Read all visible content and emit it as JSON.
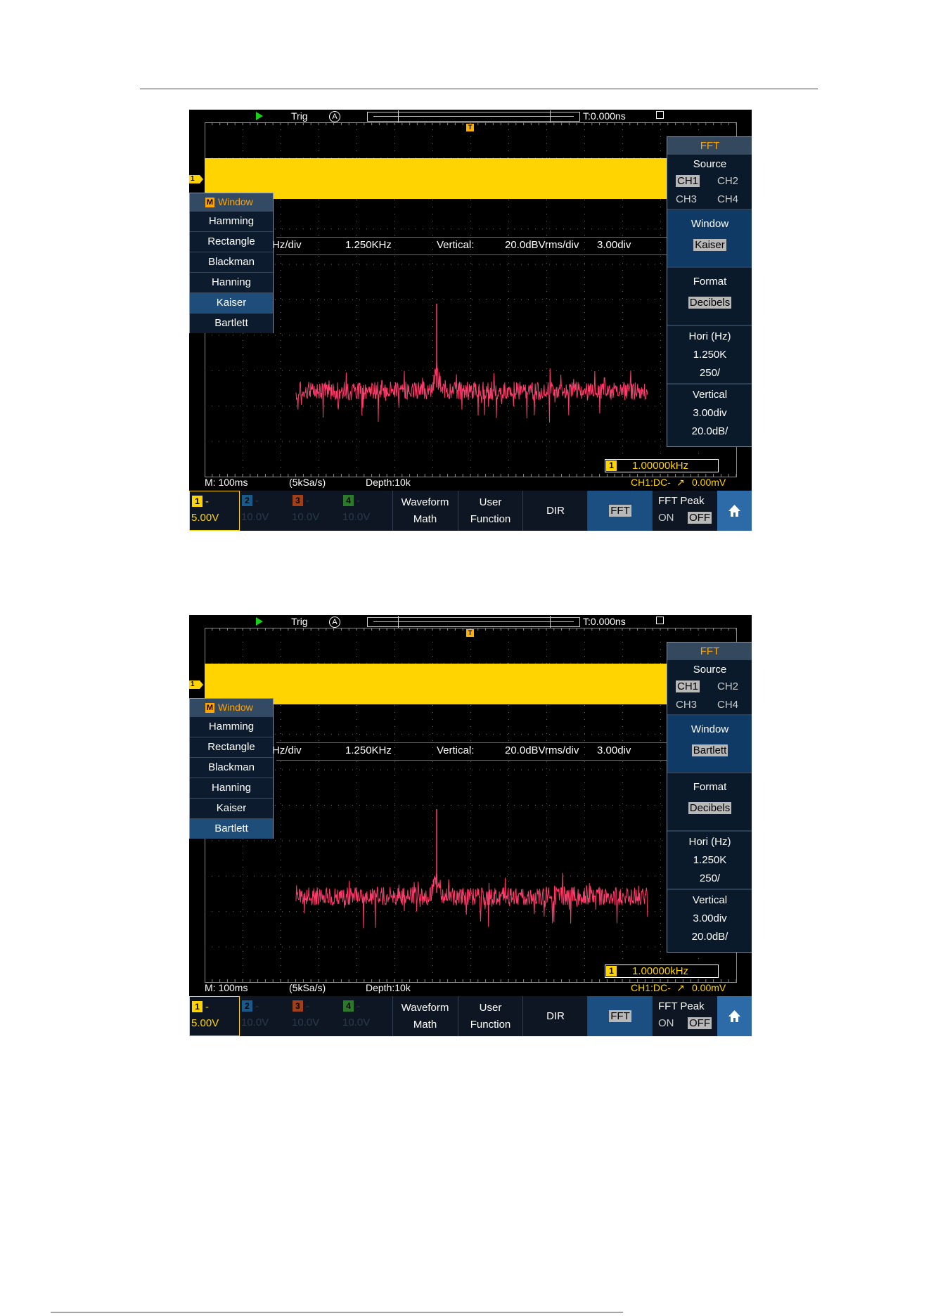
{
  "screens": [
    {
      "topbar": {
        "trig_label": "Trig",
        "auto_label": "A",
        "time_label": "T:0.000ns"
      },
      "ch1_marker": "1",
      "t_marker": "T",
      "window_menu": {
        "m": "M",
        "title": "Window",
        "items": [
          "Hamming",
          "Rectangle",
          "Blackman",
          "Hanning",
          "Kaiser",
          "Bartlett"
        ],
        "selected": "Kaiser"
      },
      "fft_info": {
        "hz_div": "Hz/div",
        "freq": "1.250KHz",
        "vertical": "Vertical:",
        "dbvrms": "20.0dBVrms/div",
        "div": "3.00div"
      },
      "side_menu": {
        "title": "FFT",
        "source_label": "Source",
        "source_options": [
          "CH1",
          "CH2",
          "CH3",
          "CH4"
        ],
        "source_selected": "CH1",
        "window_label": "Window",
        "window_value": "Kaiser",
        "format_label": "Format",
        "format_value": "Decibels",
        "hori_label": "Hori (Hz)",
        "hori_value1": "1.250K",
        "hori_value2": "250/",
        "vertical_label": "Vertical",
        "vertical_value1": "3.00div",
        "vertical_value2": "20.0dB/"
      },
      "freq_counter": {
        "num": "1",
        "value": "1.00000kHz"
      },
      "status": {
        "timebase": "M: 100ms",
        "sample": "(5kSa/s)",
        "depth": "Depth:10k",
        "trigger": "CH1:DC-",
        "level": "0.00mV"
      },
      "channels": [
        {
          "num": "1",
          "dash": "-",
          "value": "5.00V",
          "color": "#ffd400"
        },
        {
          "num": "2",
          "dash": "-",
          "value": "10.0V",
          "color": "#1a5a8a"
        },
        {
          "num": "3",
          "dash": "-",
          "value": "10.0V",
          "color": "#a0401a"
        },
        {
          "num": "4",
          "dash": "-",
          "value": "10.0V",
          "color": "#2a7a2a"
        }
      ],
      "menu": {
        "waveform_line1": "Waveform",
        "waveform_line2": "Math",
        "user_line1": "User",
        "user_line2": "Function",
        "dir": "DIR",
        "fft": "FFT",
        "fft_peak": "FFT Peak",
        "on": "ON",
        "off": "OFF"
      }
    },
    {
      "topbar": {
        "trig_label": "Trig",
        "auto_label": "A",
        "time_label": "T:0.000ns"
      },
      "ch1_marker": "1",
      "t_marker": "T",
      "window_menu": {
        "m": "M",
        "title": "Window",
        "items": [
          "Hamming",
          "Rectangle",
          "Blackman",
          "Hanning",
          "Kaiser",
          "Bartlett"
        ],
        "selected": "Bartlett"
      },
      "fft_info": {
        "hz_div": "Hz/div",
        "freq": "1.250KHz",
        "vertical": "Vertical:",
        "dbvrms": "20.0dBVrms/div",
        "div": "3.00div"
      },
      "side_menu": {
        "title": "FFT",
        "source_label": "Source",
        "source_options": [
          "CH1",
          "CH2",
          "CH3",
          "CH4"
        ],
        "source_selected": "CH1",
        "window_label": "Window",
        "window_value": "Bartlett",
        "format_label": "Format",
        "format_value": "Decibels",
        "hori_label": "Hori (Hz)",
        "hori_value1": "1.250K",
        "hori_value2": "250/",
        "vertical_label": "Vertical",
        "vertical_value1": "3.00div",
        "vertical_value2": "20.0dB/"
      },
      "freq_counter": {
        "num": "1",
        "value": "1.00000kHz"
      },
      "status": {
        "timebase": "M: 100ms",
        "sample": "(5kSa/s)",
        "depth": "Depth:10k",
        "trigger": "CH1:DC-",
        "level": "0.00mV"
      },
      "channels": [
        {
          "num": "1",
          "dash": "-",
          "value": "5.00V",
          "color": "#ffd400"
        },
        {
          "num": "2",
          "dash": "-",
          "value": "10.0V",
          "color": "#1a5a8a"
        },
        {
          "num": "3",
          "dash": "-",
          "value": "10.0V",
          "color": "#a0401a"
        },
        {
          "num": "4",
          "dash": "-",
          "value": "10.0V",
          "color": "#2a7a2a"
        }
      ],
      "menu": {
        "waveform_line1": "Waveform",
        "waveform_line2": "Math",
        "user_line1": "User",
        "user_line2": "Function",
        "dir": "DIR",
        "fft": "FFT",
        "fft_peak": "FFT Peak",
        "on": "ON",
        "off": "OFF"
      }
    }
  ],
  "colors": {
    "signal": "#ffd400",
    "spectrum": "#ff3b6b",
    "menu_highlight": "#1d4d78",
    "accent": "#ffa500"
  }
}
